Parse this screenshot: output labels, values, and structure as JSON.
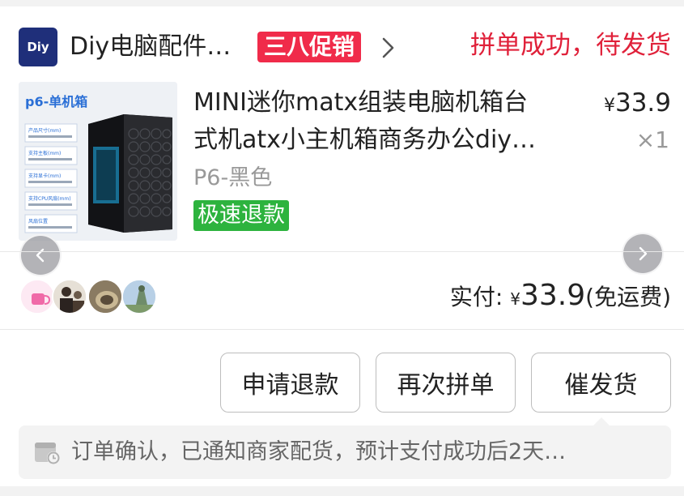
{
  "shop": {
    "logo_text": "Diy",
    "name": "Diy电脑配件…",
    "promo_tag": "三八促销",
    "order_status": "拼单成功，待发货"
  },
  "product": {
    "image_label": "p6-单机箱",
    "image_spec_lines": [
      "产品尺寸(mm)",
      "支持主板(mm)",
      "支持显卡(mm)",
      "支持CPU风扇(mm)",
      "风扇位置"
    ],
    "title_line1": "MINI迷你matx组装电脑机箱台",
    "title_line2": "式机atx小主机箱商务办公diy…",
    "price_symbol": "¥",
    "price": "33.9",
    "quantity": "×1",
    "sku": "P6-黑色",
    "refund_tag": "极速退款"
  },
  "payment": {
    "label": "实付:",
    "symbol": "¥",
    "amount": "33.9",
    "shipping": "(免运费)"
  },
  "actions": {
    "refund": "申请退款",
    "group_again": "再次拼单",
    "urge_shipping": "催发货"
  },
  "notice": {
    "text": "订单确认，已通知商家配货，预计支付成功后2天…"
  },
  "colors": {
    "status_red": "#e0213a",
    "promo_red": "#f02b4a",
    "refund_green": "#2db33e",
    "logo_navy": "#1f2f7a"
  },
  "icons": [
    "chevron-right-icon",
    "chevron-left-icon",
    "calendar-clock-icon"
  ]
}
